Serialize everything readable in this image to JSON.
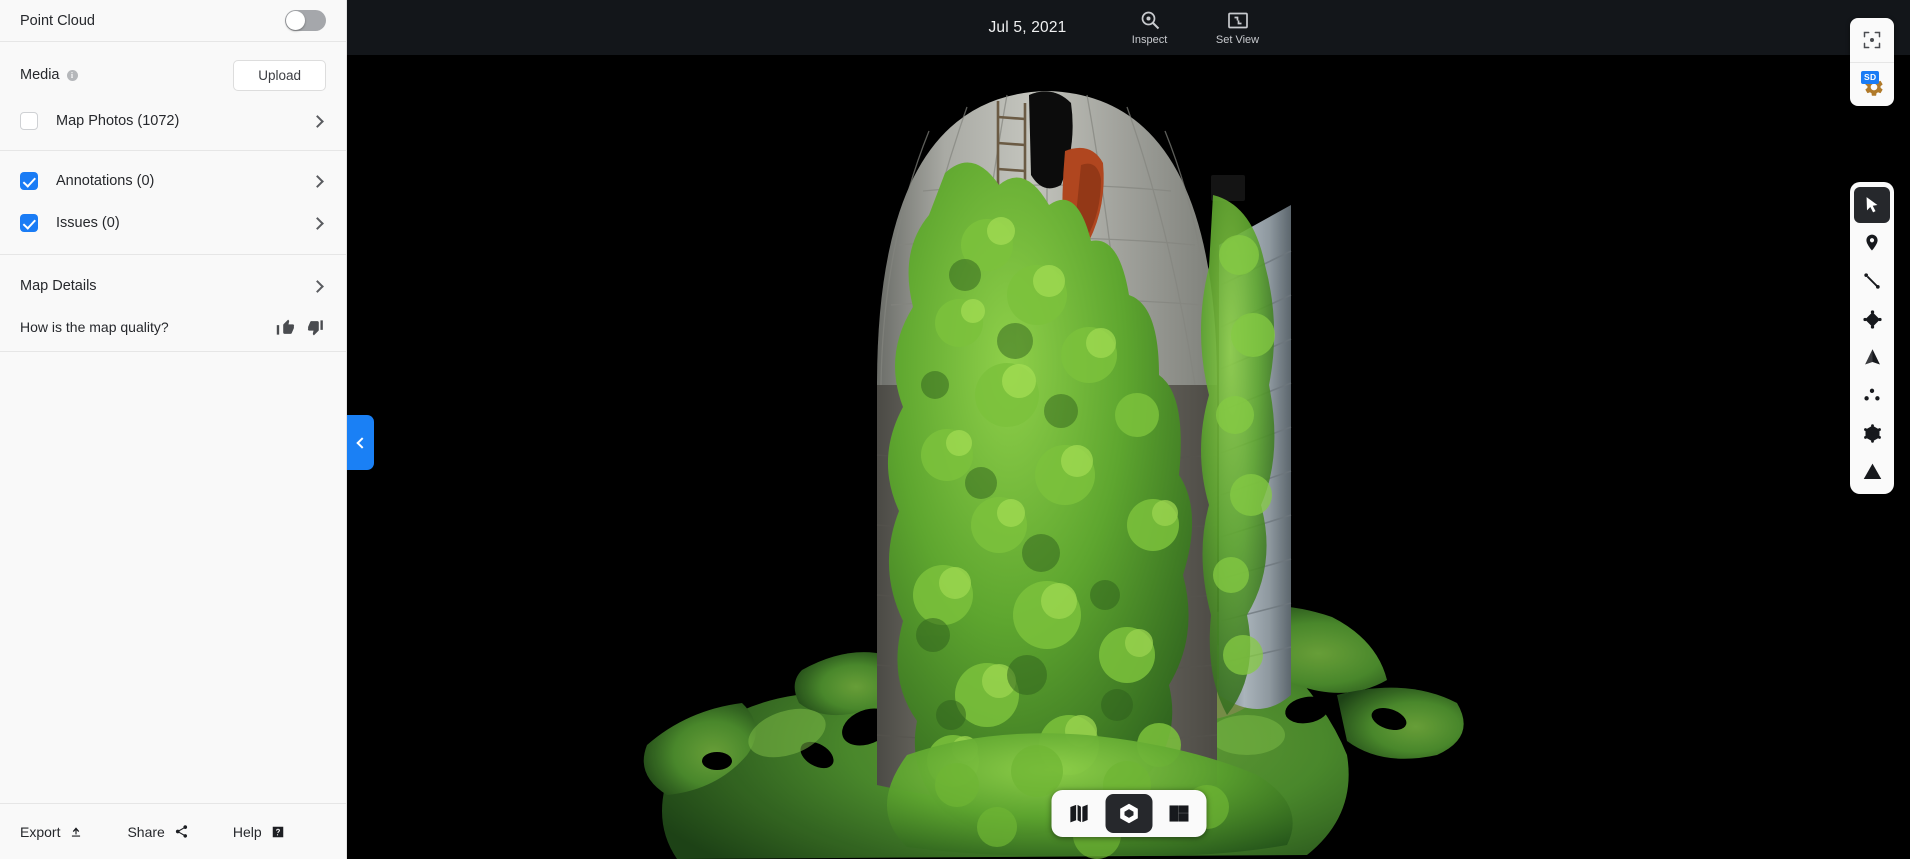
{
  "sidebar": {
    "point_cloud": {
      "label": "Point Cloud",
      "state": "off"
    },
    "media": {
      "label": "Media",
      "info_icon": "info-icon",
      "upload_label": "Upload",
      "items": [
        {
          "label": "Map Photos (1072)",
          "checked": false
        }
      ]
    },
    "layers": [
      {
        "label": "Annotations (0)",
        "checked": true
      },
      {
        "label": "Issues (0)",
        "checked": true
      }
    ],
    "details": {
      "label": "Map Details"
    },
    "quality": {
      "question": "How is the map quality?",
      "thumbs_up_icon": "thumbs-up-icon",
      "thumbs_down_icon": "thumbs-down-icon"
    },
    "footer": [
      {
        "label": "Export",
        "icon": "upload-arrow-icon"
      },
      {
        "label": "Share",
        "icon": "share-nodes-icon"
      },
      {
        "label": "Help",
        "icon": "question-mark-box-icon"
      }
    ],
    "collapse": {
      "icon": "chevron-left-icon"
    }
  },
  "topbar": {
    "date": "Jul 5, 2021",
    "actions": [
      {
        "label": "Inspect",
        "icon": "magnifier-inspect-icon"
      },
      {
        "label": "Set View",
        "icon": "set-view-frame-icon"
      }
    ]
  },
  "right_controls": [
    {
      "name": "recenter-view",
      "icon": "focus-target-icon",
      "badge": null
    },
    {
      "name": "quality-settings",
      "icon": "gear-icon",
      "badge": "SD"
    }
  ],
  "tool_palette": [
    {
      "name": "select-tool",
      "icon": "cursor-arrow-icon",
      "active": true
    },
    {
      "name": "marker-tool",
      "icon": "map-pin-icon",
      "active": false
    },
    {
      "name": "distance-tool",
      "icon": "line-measure-icon",
      "active": false
    },
    {
      "name": "area-tool",
      "icon": "polygon-area-icon",
      "active": false
    },
    {
      "name": "elevation-tool",
      "icon": "elevation-cone-icon",
      "active": false
    },
    {
      "name": "points-tool",
      "icon": "three-dots-icon",
      "active": false
    },
    {
      "name": "volume-tool",
      "icon": "cube-wireframe-icon",
      "active": false
    },
    {
      "name": "issue-tool",
      "icon": "warning-triangle-icon",
      "active": false
    }
  ],
  "view_switcher": [
    {
      "name": "map-view",
      "icon": "folded-map-icon",
      "active": false
    },
    {
      "name": "model-view",
      "icon": "cube-3d-icon",
      "active": true
    },
    {
      "name": "split-view",
      "icon": "split-panels-icon",
      "active": false
    }
  ],
  "colors": {
    "accent": "#1a7cf5",
    "sidebar_bg": "#f9f9f9",
    "topbar_bg": "#13161a",
    "viewport_bg": "#000000",
    "tool_active_bg": "#26282c"
  },
  "scene": {
    "subject": "3D photogrammetry model of an ivy-covered concrete silo with fragmented green terrain mesh"
  }
}
